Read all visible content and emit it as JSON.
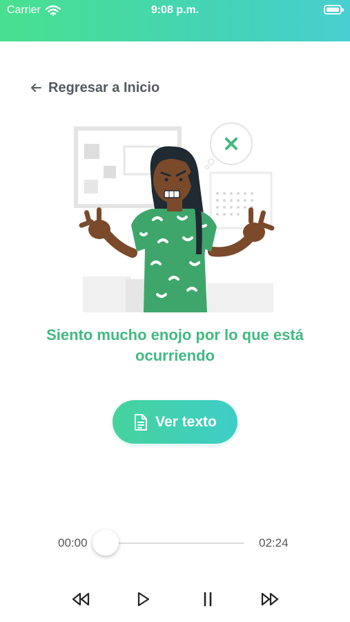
{
  "status_bar": {
    "carrier": "Carrier",
    "time": "9:08 p.m."
  },
  "nav": {
    "back_label": "Regresar a Inicio"
  },
  "message": "Siento mucho enojo por lo que está ocurriendo",
  "primary_button": {
    "label": "Ver texto"
  },
  "player": {
    "current_time": "00:00",
    "total_time": "02:24",
    "progress": 0
  },
  "colors": {
    "accent_green": "#41b981",
    "gradient_start": "#48e08f",
    "gradient_end": "#48cfd1"
  },
  "icons": [
    "wifi-icon",
    "battery-icon",
    "back-arrow-icon",
    "document-icon",
    "rewind-icon",
    "play-icon",
    "pause-icon",
    "fast-forward-icon"
  ]
}
